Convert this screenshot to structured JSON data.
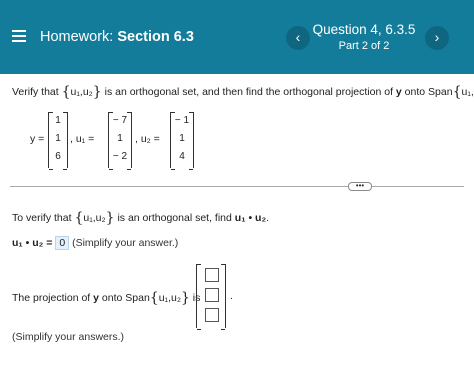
{
  "header": {
    "homework_prefix": "Homework:",
    "section": "Section 6.3",
    "question_title": "Question 4, 6.3.5",
    "part": "Part 2 of 2",
    "prev_icon": "‹",
    "next_icon": "›"
  },
  "problem": {
    "verify_text": "Verify that",
    "set_inner": "u₁,u₂",
    "middle_text": "is an orthogonal set, and then find the orthogonal projection of",
    "y": "y",
    "onto_text": "onto Span",
    "end_text": "."
  },
  "vectors": {
    "y_label": "y =",
    "y": [
      "1",
      "1",
      "6"
    ],
    "u1_label": ", u₁ =",
    "u1": [
      "− 7",
      "1",
      "− 2"
    ],
    "u2_label": ", u₂ =",
    "u2": [
      "− 1",
      "1",
      "4"
    ]
  },
  "more_button": "•••",
  "part1": {
    "text_before": "To verify that",
    "set_inner": "u₁,u₂",
    "text_after": "is an orthogonal set, find",
    "dot_expr": "u₁ • u₂",
    "period": ".",
    "lhs": "u₁ • u₂ =",
    "answer": "0",
    "hint": "(Simplify your answer.)"
  },
  "part2": {
    "text_before": "The projection of",
    "y": "y",
    "onto_text": "onto Span",
    "set_inner": "u₁,u₂",
    "is_text": "is",
    "period": ".",
    "hint": "(Simplify your answers.)"
  },
  "colors": {
    "header_bg": "#137c9b",
    "answer_bg": "#e4f0fb"
  }
}
